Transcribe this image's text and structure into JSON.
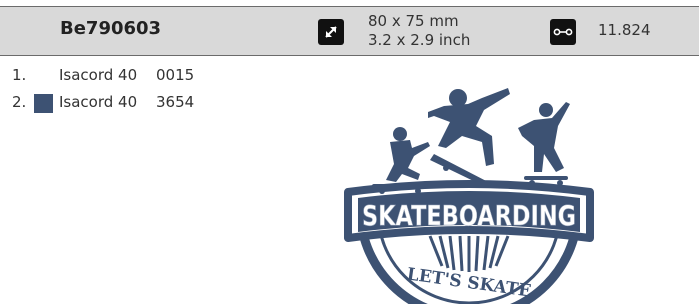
{
  "header": {
    "design_id": "Be790603",
    "size_mm": "80 x 75 mm",
    "size_inch": "3.2 x 2.9 inch",
    "stitch_count": "11.824",
    "size_icon": "resize-arrows-icon",
    "stitch_icon": "stitch-count-icon"
  },
  "threads": [
    {
      "num": "1.",
      "name": "Isacord 40",
      "code": "0015",
      "color": "#ffffff"
    },
    {
      "num": "2.",
      "name": "Isacord 40",
      "code": "3654",
      "color": "#3d5273"
    }
  ],
  "design": {
    "title_text": "SKATEBOARDING",
    "subtitle_text": "LET'S SKATE",
    "thread_color": "#3d5273"
  }
}
